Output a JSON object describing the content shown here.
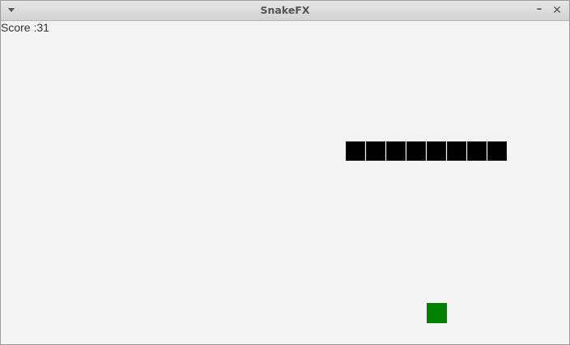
{
  "window": {
    "title": "SnakeFX",
    "menu_icon": "chevron-down-icon",
    "minimize_icon": "minimize-icon",
    "close_icon": "close-icon"
  },
  "game": {
    "score_label": "Score :31",
    "score": 31,
    "snake_length": 8,
    "snake_color": "#000000",
    "food_color": "#008000",
    "background_color": "#f4f4f4"
  }
}
